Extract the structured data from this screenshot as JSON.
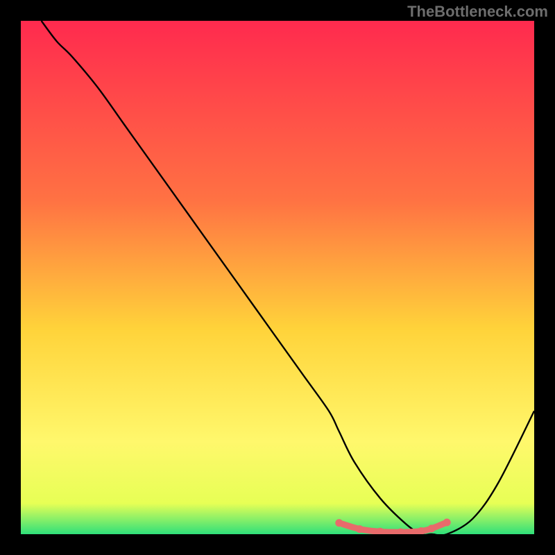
{
  "watermark": "TheBottleneck.com",
  "colors": {
    "background": "#000000",
    "watermark_text": "#6d6d6d",
    "curve": "#000000",
    "dots": "#e86b6b",
    "gradient_top": "#ff2a4e",
    "gradient_mid_upper": "#ff7243",
    "gradient_mid": "#ffd33a",
    "gradient_lower": "#fff86c",
    "gradient_bottom": "#2fe07a"
  },
  "chart_data": {
    "type": "line",
    "title": "",
    "xlabel": "",
    "ylabel": "",
    "x_range": [
      0,
      100
    ],
    "y_range": [
      0,
      100
    ],
    "series": [
      {
        "name": "bottleneck-curve",
        "x": [
          4,
          7,
          10,
          15,
          20,
          25,
          30,
          35,
          40,
          45,
          50,
          55,
          60,
          62,
          65,
          70,
          75,
          78,
          80,
          83,
          88,
          93,
          100
        ],
        "values": [
          100,
          96,
          93,
          87,
          80,
          73,
          66,
          59,
          52,
          45,
          38,
          31,
          24,
          20,
          14,
          7,
          2,
          0,
          0,
          0,
          3,
          10,
          24
        ]
      }
    ],
    "highlight_region": {
      "name": "optimal-range",
      "x": [
        62,
        66,
        70,
        74,
        78,
        80,
        83
      ],
      "values": [
        2.2,
        1.0,
        0.5,
        0.4,
        0.6,
        1.1,
        2.3
      ]
    },
    "gradient_stops": [
      {
        "offset": 0.0,
        "color": "#ff2a4e"
      },
      {
        "offset": 0.35,
        "color": "#ff7243"
      },
      {
        "offset": 0.6,
        "color": "#ffd33a"
      },
      {
        "offset": 0.82,
        "color": "#fff86c"
      },
      {
        "offset": 0.94,
        "color": "#e7ff55"
      },
      {
        "offset": 1.0,
        "color": "#2fe07a"
      }
    ]
  }
}
